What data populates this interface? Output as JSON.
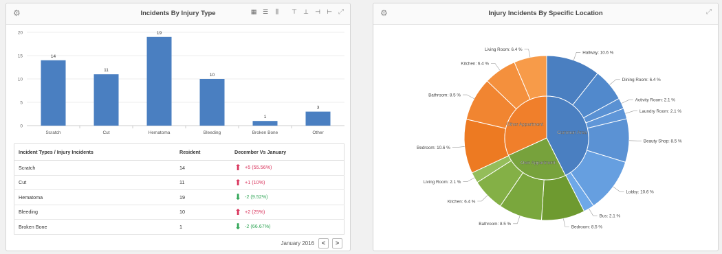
{
  "bar_panel": {
    "title": "Incidents By Injury Type",
    "gear_icon": "gear-icon",
    "toolbar_icons": [
      "grid-icon",
      "list-icon",
      "columns-icon",
      "align-top-icon",
      "align-bottom-icon",
      "align-left-icon",
      "align-right-icon"
    ],
    "expand_icon": "expand-icon"
  },
  "table": {
    "headers": [
      "Incident Types / Injury Incidents",
      "Resident",
      "December Vs January"
    ],
    "rows": [
      {
        "type": "Scratch",
        "resident": "14",
        "direction": "up",
        "change": "+5 (55.56%)"
      },
      {
        "type": "Cut",
        "resident": "11",
        "direction": "up",
        "change": "+1 (10%)"
      },
      {
        "type": "Hematoma",
        "resident": "19",
        "direction": "down",
        "change": "-2 (9.52%)"
      },
      {
        "type": "Bleeding",
        "resident": "10",
        "direction": "up",
        "change": "+2 (25%)"
      },
      {
        "type": "Broken Bone",
        "resident": "1",
        "direction": "down",
        "change": "-2 (66.67%)"
      }
    ]
  },
  "pager": {
    "label": "January 2016",
    "prev": "<",
    "next": ">"
  },
  "pie_panel": {
    "title": "Injury Incidents By Specific Location",
    "gear_icon": "gear-icon",
    "expand_icon": "expand-icon"
  },
  "chart_data": [
    {
      "type": "bar",
      "categories": [
        "Scratch",
        "Cut",
        "Hematoma",
        "Bleeding",
        "Broken Bone",
        "Other"
      ],
      "values": [
        14,
        11,
        19,
        10,
        1,
        3
      ],
      "ylim": [
        0,
        20
      ],
      "yticks": [
        0,
        5,
        10,
        15,
        20
      ],
      "color": "#4a7fc1",
      "grid": true
    },
    {
      "type": "pie",
      "inner": [
        {
          "name": "Common Area",
          "value": 42.6,
          "color": "#4a7fc1"
        },
        {
          "name": "Own Appartment",
          "value": 25.6,
          "color": "#77a23c"
        },
        {
          "name": "Other Appartment",
          "value": 31.8,
          "color": "#f07f2b"
        }
      ],
      "outer": [
        {
          "name": "Hallway: 10.6 %",
          "value": 10.6,
          "color": "#4a7fc1"
        },
        {
          "name": "Dining Room: 6.4 %",
          "value": 6.4,
          "color": "#5189cc"
        },
        {
          "name": "Activity Room: 2.1 %",
          "value": 2.1,
          "color": "#5a91d3"
        },
        {
          "name": "Laundry Room: 2.1 %",
          "value": 2.1,
          "color": "#5f96d8"
        },
        {
          "name": "Beauty Shop: 8.5 %",
          "value": 8.5,
          "color": "#5b92d4"
        },
        {
          "name": "Lobby: 10.6 %",
          "value": 10.6,
          "color": "#669fe0"
        },
        {
          "name": "Bus: 2.1 %",
          "value": 2.1,
          "color": "#6ea8e8"
        },
        {
          "name": "Bedroom: 8.5 %",
          "value": 8.5,
          "color": "#6e9a30"
        },
        {
          "name": "Bathroom: 8.5 %",
          "value": 8.5,
          "color": "#7aa73d"
        },
        {
          "name": "Kitchen: 6.4 %",
          "value": 6.4,
          "color": "#84b046"
        },
        {
          "name": "Living Room: 2.1 %",
          "value": 2.1,
          "color": "#94bd5a"
        },
        {
          "name": "Bedroom: 10.6 %",
          "value": 10.6,
          "color": "#ed7a22"
        },
        {
          "name": "Bathroom: 8.5 %",
          "value": 8.5,
          "color": "#f18531"
        },
        {
          "name": "Kitchen: 6.4 %",
          "value": 6.4,
          "color": "#f4903d"
        },
        {
          "name": "Living Room: 6.4 %",
          "value": 6.4,
          "color": "#f79b49"
        }
      ]
    }
  ]
}
